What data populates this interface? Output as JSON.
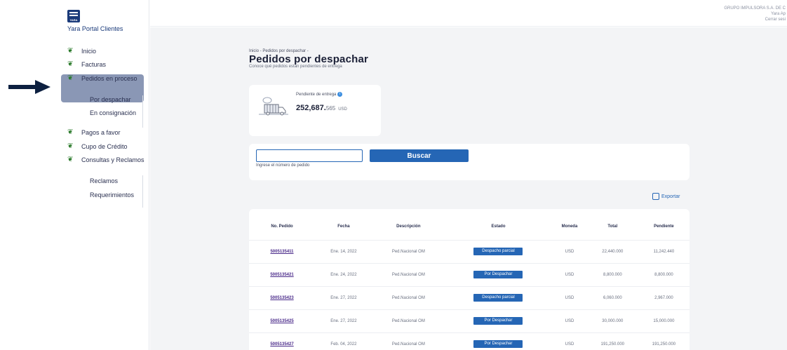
{
  "app": {
    "logo_text": "YARA",
    "name": "Yara Portal Clientes"
  },
  "sidebar": {
    "items": [
      {
        "label": "Inicio",
        "icon": "leaf-icon"
      },
      {
        "label": "Facturas",
        "icon": "leaf-icon"
      },
      {
        "label": "Pedidos en proceso",
        "icon": "leaf-icon"
      },
      {
        "label": "Pagos a favor",
        "icon": "leaf-icon"
      },
      {
        "label": "Cupo de Crédito",
        "icon": "leaf-icon"
      },
      {
        "label": "Consultas y Reclamos",
        "icon": "leaf-icon"
      }
    ],
    "pedidos_sub": [
      "Por despachar",
      "En consignación"
    ],
    "consultas_sub": [
      "Reclamos",
      "Requerimientos"
    ]
  },
  "topbar": {
    "company": "GRUPO IMPULSORA S.A. DE C",
    "user": "Yara Ap",
    "logout": "Cerrar sesi"
  },
  "page": {
    "breadcrumb": "Inicio - Pedidos por despachar -",
    "title": "Pedidos por despachar",
    "subtitle": "Conoce qué pedidos están pendientes de entrega"
  },
  "summary": {
    "label": "Pendiente de entrega",
    "value_int": "252,687.",
    "value_dec": "565",
    "currency": "USD"
  },
  "search": {
    "value": "",
    "hint": "Ingrese el número de pedido",
    "button": "Buscar"
  },
  "export_label": "Exportar",
  "table": {
    "headers": [
      "No. Pedido",
      "Fecha",
      "Descripción",
      "Estado",
      "Moneda",
      "Total",
      "Pendiente"
    ],
    "rows": [
      {
        "pedido": "5005135411",
        "fecha": "Ene. 14, 2022",
        "descripcion": "Ped.Nacional OM",
        "estado": "Despacho parcial",
        "moneda": "USD",
        "total": "22,440.000",
        "pendiente": "11,242.440"
      },
      {
        "pedido": "5005135421",
        "fecha": "Ene. 24, 2022",
        "descripcion": "Ped.Nacional OM",
        "estado": "Por Despachar",
        "moneda": "USD",
        "total": "8,800.000",
        "pendiente": "8,800.000"
      },
      {
        "pedido": "5005135423",
        "fecha": "Ene. 27, 2022",
        "descripcion": "Ped.Nacional OM",
        "estado": "Despacho parcial",
        "moneda": "USD",
        "total": "6,060.000",
        "pendiente": "2,967.000"
      },
      {
        "pedido": "5005135425",
        "fecha": "Ene. 27, 2022",
        "descripcion": "Ped.Nacional OM",
        "estado": "Por Despachar",
        "moneda": "USD",
        "total": "30,000.000",
        "pendiente": "15,000.000"
      },
      {
        "pedido": "5005135427",
        "fecha": "Feb. 04, 2022",
        "descripcion": "Ped.Nacional OM",
        "estado": "Por Despachar",
        "moneda": "USD",
        "total": "191,250.000",
        "pendiente": "191,250.000"
      }
    ]
  },
  "colors": {
    "primary": "#2566b5",
    "nav_active": "#8a97b5",
    "arrow": "#0d2040"
  }
}
